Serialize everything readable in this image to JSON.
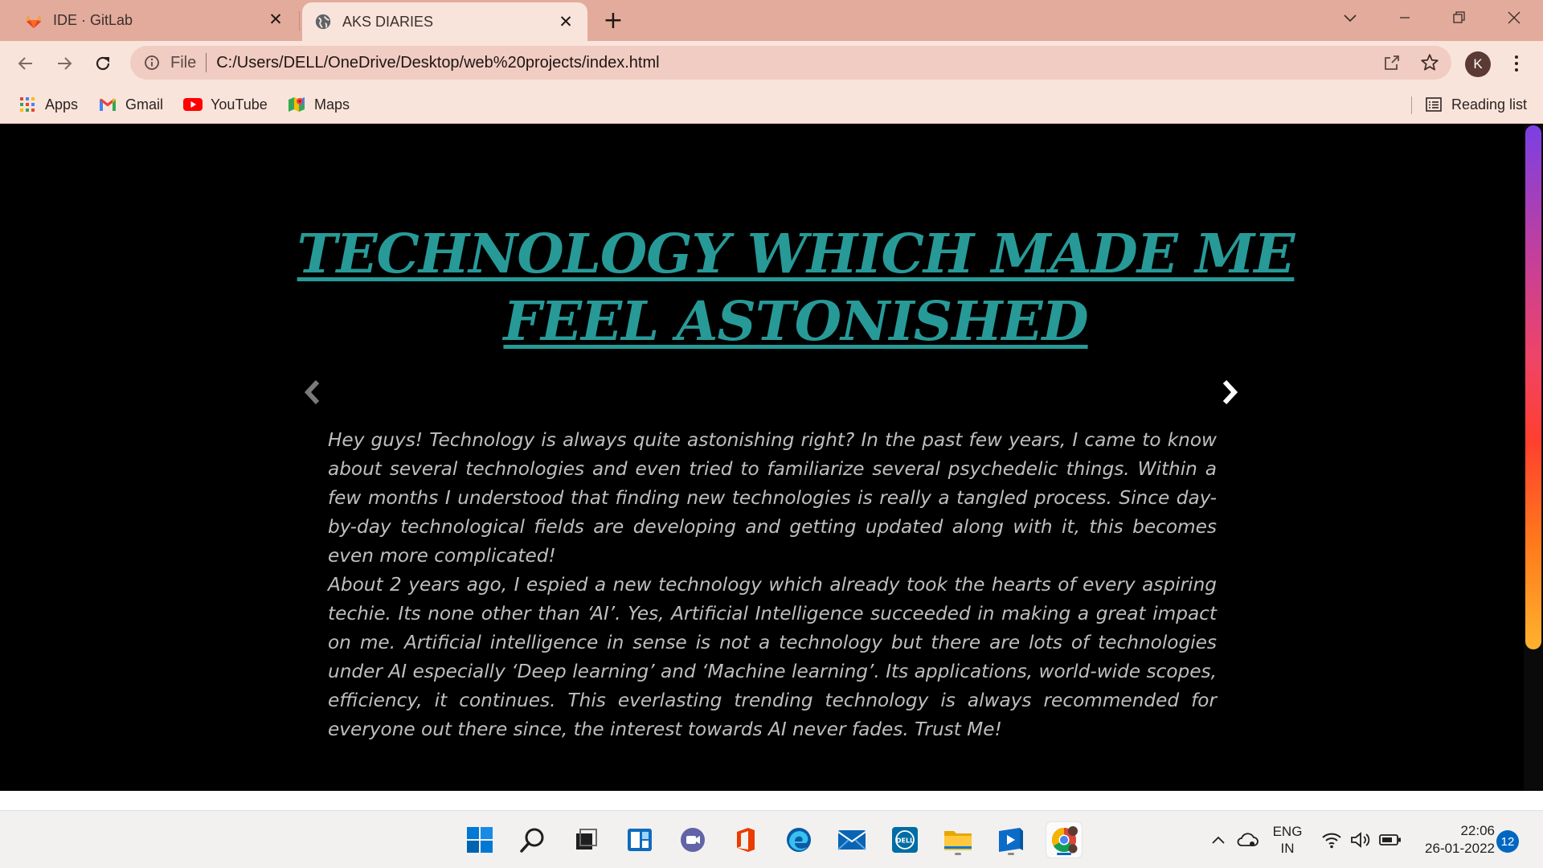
{
  "browser": {
    "tabs": [
      {
        "title": "IDE · GitLab",
        "favicon": "gitlab-icon",
        "active": false
      },
      {
        "title": "AKS DIARIES",
        "favicon": "globe-icon",
        "active": true
      }
    ],
    "tab_close_glyph": "✕",
    "new_tab_glyph": "+",
    "address_bar": {
      "scheme_label": "File",
      "url": "C:/Users/DELL/OneDrive/Desktop/web%20projects/index.html"
    },
    "profile_initial": "K",
    "bookmarks": [
      {
        "label": "Apps",
        "icon": "apps-grid-icon"
      },
      {
        "label": "Gmail",
        "icon": "gmail-icon"
      },
      {
        "label": "YouTube",
        "icon": "youtube-icon"
      },
      {
        "label": "Maps",
        "icon": "maps-icon"
      }
    ],
    "reading_list_label": "Reading list"
  },
  "page": {
    "title": "TECHNOLOGY WHICH MADE ME FEEL ASTONISHED",
    "paragraphs": [
      "Hey guys! Technology is always quite astonishing right? In the past few years, I came to know about several technologies and even tried to familiarize several psychedelic things. Within a few months I understood that finding new technologies is really a tangled process. Since day-by-day technological fields are developing and getting updated along with it, this becomes even more complicated!",
      "About 2 years ago, I espied a new technology which already took the hearts of every aspiring techie. Its none other than ‘AI’. Yes, Artificial Intelligence succeeded in making a great impact on me. Artificial intelligence in sense is not a technology but there are lots of technologies under AI especially ‘Deep learning’ and ‘Machine learning’. Its applications, world-wide scopes, efficiency, it continues. This everlasting trending technology is always recommended for everyone out there since, the interest towards AI never fades. Trust Me!"
    ],
    "title_color": "#279a98",
    "text_color": "#bfbfbf",
    "background_color": "#000000"
  },
  "taskbar": {
    "apps": [
      "windows-start-icon",
      "search-icon",
      "task-view-icon",
      "widgets-icon",
      "teams-chat-icon",
      "office-icon",
      "edge-icon",
      "mail-icon",
      "dell-icon",
      "file-explorer-icon",
      "media-player-icon",
      "chrome-icon"
    ],
    "language": {
      "line1": "ENG",
      "line2": "IN"
    },
    "clock": {
      "time": "22:06",
      "date": "26-01-2022"
    },
    "notification_count": "12"
  },
  "theme": {
    "tabstrip_color": "#e3ab9c",
    "toolbar_color": "#f9e4dc",
    "accent_blue": "#0067c0"
  }
}
